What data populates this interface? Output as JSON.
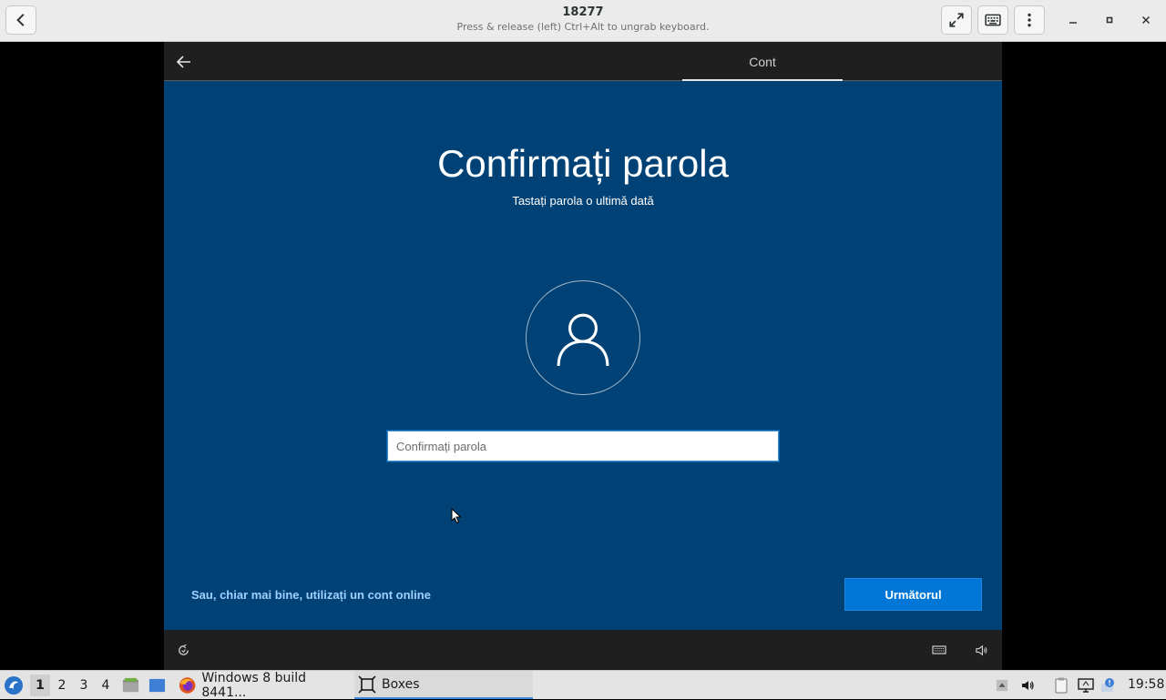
{
  "header": {
    "title": "18277",
    "subtitle": "Press & release (left) Ctrl+Alt to ungrab keyboard."
  },
  "vm": {
    "nav_tab": "Cont",
    "title": "Confirmați parola",
    "subtitle": "Tastați parola o ultimă dată",
    "password_placeholder": "Confirmați parola",
    "password_value": "",
    "online_account_link": "Sau, chiar mai bine, utilizați un cont online",
    "next_button": "Următorul",
    "accent_color": "#004275",
    "button_color": "#0077d7"
  },
  "taskbar": {
    "workspaces": [
      "1",
      "2",
      "3",
      "4"
    ],
    "active_workspace": "1",
    "tasks": [
      {
        "label": "Windows 8 build 8441...",
        "icon": "firefox-icon"
      },
      {
        "label": "Boxes",
        "icon": "boxes-icon"
      }
    ],
    "clock": "19:58"
  }
}
